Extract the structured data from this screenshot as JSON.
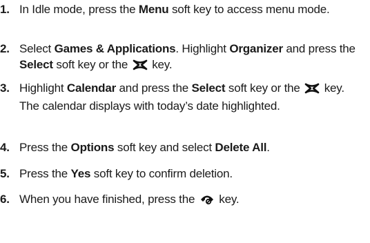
{
  "steps": [
    {
      "number": "1.",
      "parts": [
        "In Idle mode, press the ",
        "Menu",
        " soft key to access menu mode."
      ]
    },
    {
      "number": "2.",
      "parts": [
        "Select ",
        "Games & Applications",
        ". Highlight ",
        "Organizer",
        " and press the ",
        "Select",
        " soft key or the ",
        " key."
      ]
    },
    {
      "number": "3.",
      "parts": [
        "Highlight ",
        "Calendar",
        " and press the ",
        "Select",
        " soft key or the ",
        " key. The calendar displays with today’s date highlighted."
      ]
    },
    {
      "number": "4.",
      "parts": [
        "Press the ",
        "Options",
        " soft key and select ",
        "Delete All",
        "."
      ]
    },
    {
      "number": "5.",
      "parts": [
        "Press the ",
        "Yes",
        " soft key to confirm deletion."
      ]
    },
    {
      "number": "6.",
      "parts": [
        "When you have finished, press the ",
        " key."
      ]
    }
  ],
  "icons": {
    "select_key": "select-key-icon",
    "end_key": "end-key-icon"
  }
}
